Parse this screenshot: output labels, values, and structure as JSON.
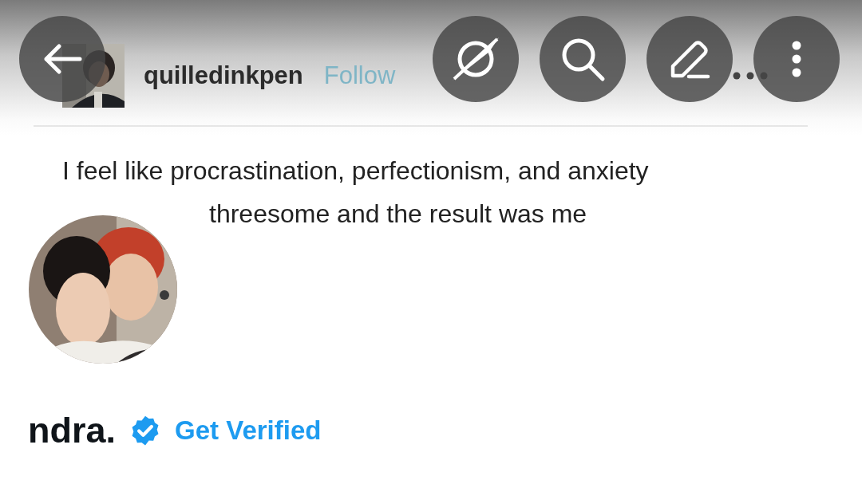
{
  "banner": {
    "kind": "post-screenshot",
    "author": "quilledinkpen",
    "follow_label": "Follow",
    "text_lines": [
      "I feel like procrastination, perfectionism, and anxiety",
      "threesome and the result was me"
    ]
  },
  "toolbar": {
    "buttons": [
      {
        "kind": "back"
      },
      {
        "kind": "hide"
      },
      {
        "kind": "search"
      },
      {
        "kind": "compose"
      },
      {
        "kind": "more"
      }
    ]
  },
  "profile": {
    "name": "ndra.",
    "verified": true,
    "verify_link": "Get Verified"
  }
}
